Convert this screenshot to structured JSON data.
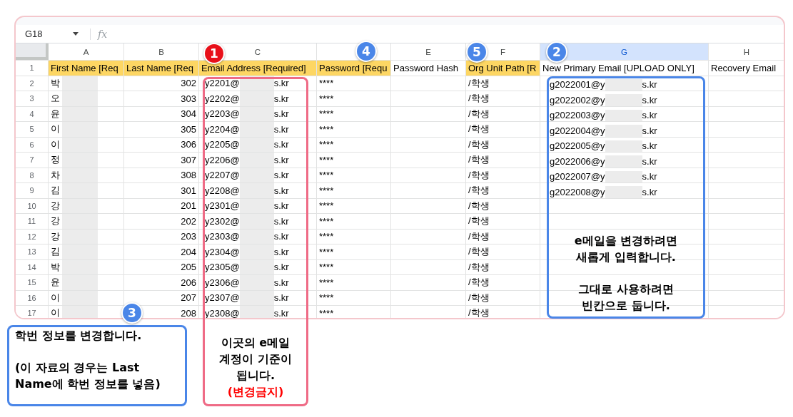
{
  "formula_bar": {
    "cell_ref": "G18",
    "fx": "fx"
  },
  "columns": [
    {
      "label": "A",
      "selected": false
    },
    {
      "label": "B",
      "selected": false
    },
    {
      "label": "C",
      "selected": false
    },
    {
      "label": "E",
      "selected": false
    },
    {
      "label": "F",
      "selected": false
    },
    {
      "label": "G",
      "selected": true
    },
    {
      "label": "H",
      "selected": false
    }
  ],
  "header_row": {
    "number": "1",
    "cells": [
      {
        "text": "First Name [Req",
        "required": true
      },
      {
        "text": "Last Name [Req",
        "required": true
      },
      {
        "text": "Email Address [Required]",
        "required": true
      },
      {
        "text": "Password [Requ",
        "required": true
      },
      {
        "text": "Password Hash",
        "required": false
      },
      {
        "text": "Org Unit Path [R",
        "required": true
      },
      {
        "text": "New Primary Email [UPLOAD ONLY]",
        "required": false
      },
      {
        "text": "Recovery Email",
        "required": false
      }
    ]
  },
  "rows": [
    {
      "number": "2",
      "first_name": "박",
      "last_name": "302",
      "email": {
        "local": "y2201@",
        "domain": "s.kr"
      },
      "password": "****",
      "org_unit": "/학생",
      "new_email": {
        "local": "g2022001@y",
        "domain": "s.kr"
      }
    },
    {
      "number": "3",
      "first_name": "오",
      "last_name": "303",
      "email": {
        "local": "y2202@",
        "domain": "s.kr"
      },
      "password": "****",
      "org_unit": "/학생",
      "new_email": {
        "local": "g2022002@y",
        "domain": "s.kr"
      }
    },
    {
      "number": "4",
      "first_name": "윤",
      "last_name": "304",
      "email": {
        "local": "y2203@",
        "domain": "s.kr"
      },
      "password": "****",
      "org_unit": "/학생",
      "new_email": {
        "local": "g2022003@y",
        "domain": "s.kr"
      }
    },
    {
      "number": "5",
      "first_name": "이",
      "last_name": "305",
      "email": {
        "local": "y2204@",
        "domain": "s.kr"
      },
      "password": "****",
      "org_unit": "/학생",
      "new_email": {
        "local": "g2022004@y",
        "domain": "s.kr"
      }
    },
    {
      "number": "6",
      "first_name": "이",
      "last_name": "306",
      "email": {
        "local": "y2205@",
        "domain": "s.kr"
      },
      "password": "****",
      "org_unit": "/학생",
      "new_email": {
        "local": "g2022005@y",
        "domain": "s.kr"
      }
    },
    {
      "number": "7",
      "first_name": "정",
      "last_name": "307",
      "email": {
        "local": "y2206@",
        "domain": "s.kr"
      },
      "password": "****",
      "org_unit": "/학생",
      "new_email": {
        "local": "g2022006@y",
        "domain": "s.kr"
      }
    },
    {
      "number": "8",
      "first_name": "차",
      "last_name": "308",
      "email": {
        "local": "y2207@",
        "domain": "s.kr"
      },
      "password": "****",
      "org_unit": "/학생",
      "new_email": {
        "local": "g2022007@y",
        "domain": "s.kr"
      }
    },
    {
      "number": "9",
      "first_name": "김",
      "last_name": "301",
      "email": {
        "local": "y2208@",
        "domain": "s.kr"
      },
      "password": "****",
      "org_unit": "/학생",
      "new_email": {
        "local": "g2022008@y",
        "domain": "s.kr"
      }
    },
    {
      "number": "10",
      "first_name": "강",
      "last_name": "201",
      "email": {
        "local": "y2301@",
        "domain": "s.kr"
      },
      "password": "****",
      "org_unit": "/학생"
    },
    {
      "number": "11",
      "first_name": "강",
      "last_name": "202",
      "email": {
        "local": "y2302@",
        "domain": "s.kr"
      },
      "password": "****",
      "org_unit": "/학생"
    },
    {
      "number": "12",
      "first_name": "강",
      "last_name": "203",
      "email": {
        "local": "y2303@",
        "domain": "s.kr"
      },
      "password": "****",
      "org_unit": "/학생"
    },
    {
      "number": "13",
      "first_name": "김",
      "last_name": "204",
      "email": {
        "local": "y2304@",
        "domain": "s.kr"
      },
      "password": "****",
      "org_unit": "/학생"
    },
    {
      "number": "14",
      "first_name": "박",
      "last_name": "205",
      "email": {
        "local": "y2305@",
        "domain": "s.kr"
      },
      "password": "****",
      "org_unit": "/학생"
    },
    {
      "number": "15",
      "first_name": "윤",
      "last_name": "206",
      "email": {
        "local": "y2306@",
        "domain": "s.kr"
      },
      "password": "****",
      "org_unit": "/학생"
    },
    {
      "number": "16",
      "first_name": "이",
      "last_name": "207",
      "email": {
        "local": "y2307@",
        "domain": "s.kr"
      },
      "password": "****",
      "org_unit": "/학생"
    },
    {
      "number": "17",
      "first_name": "이",
      "last_name": "208",
      "email": {
        "local": "y2308@",
        "domain": "s.kr"
      },
      "password": "****",
      "org_unit": "/학생"
    }
  ],
  "badges": [
    {
      "number": "1",
      "color": "#e8101a"
    },
    {
      "number": "4",
      "color": "#4a86e8"
    },
    {
      "number": "5",
      "color": "#4a86e8"
    },
    {
      "number": "2",
      "color": "#4a86e8"
    },
    {
      "number": "3",
      "color": "#4a86e8"
    }
  ],
  "callouts": [
    {
      "color": "#ef6b86",
      "paragraphs": [
        {
          "text": "이곳의 e메일\n계정이 기준이\n됩니다.",
          "warning": false
        },
        {
          "text": "(변경금지)",
          "warning": true
        }
      ]
    },
    {
      "color": "#4a86e8",
      "paragraphs": [
        {
          "text": "e메일을 변경하려면\n새롭게 입력합니다.",
          "warning": false
        },
        {
          "text": "그대로 사용하려면\n빈칸으로 둡니다.",
          "warning": false
        }
      ]
    },
    {
      "color": "#4a86e8",
      "paragraphs": [
        {
          "text": "학번 정보를 변경합니다.",
          "warning": false
        },
        {
          "text": "(이 자료의 경우는 Last\nName에 학번 정보를 넣음)",
          "warning": false
        }
      ]
    }
  ]
}
